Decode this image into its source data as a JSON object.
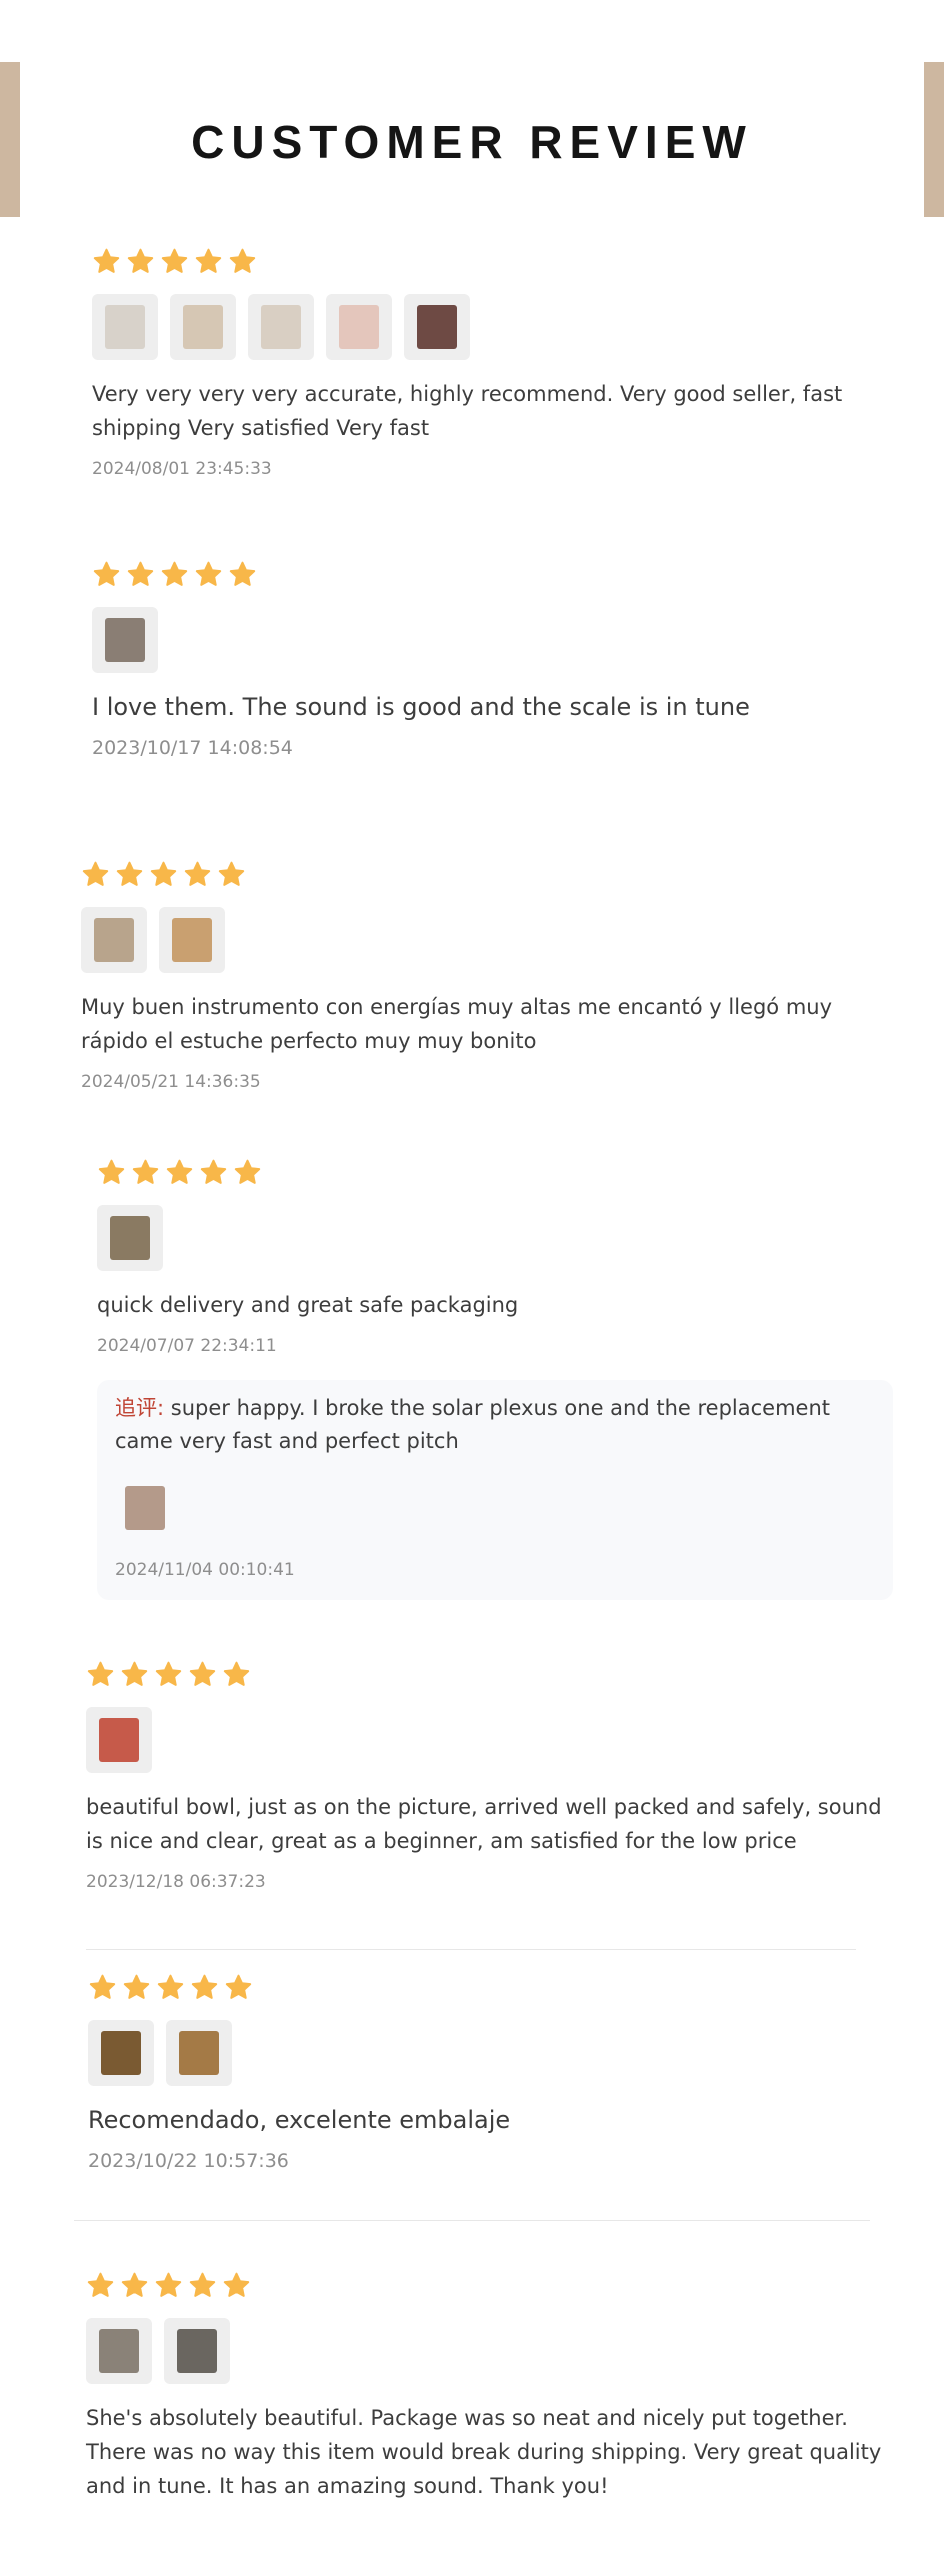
{
  "page": {
    "title": "CUSTOMER REVIEW"
  },
  "colors": {
    "accent_bar": "#cdb7a0",
    "star": "#f8b749",
    "followup_label": "#c04535",
    "date": "#8e8e8e"
  },
  "icons": {
    "star": "star-icon"
  },
  "reviews": [
    {
      "rating": 5,
      "thumbs": [
        "#d8d2ca",
        "#d6c7b4",
        "#d9cfc3",
        "#e4c6bc",
        "#6e4a44"
      ],
      "text": "Very very very very accurate, highly recommend. Very good seller, fast shipping Very satisfied Very fast",
      "date": "2024/08/01 23:45:33"
    },
    {
      "rating": 5,
      "thumbs": [
        "#8a7e74"
      ],
      "text": "I love them. The sound is good and the scale is in tune",
      "date": "2023/10/17 14:08:54"
    },
    {
      "rating": 5,
      "thumbs": [
        "#b8a48c",
        "#c9a070"
      ],
      "text": "Muy buen instrumento con energías muy altas me encantó y llegó muy rápido el estuche perfecto muy muy bonito",
      "date": "2024/05/21 14:36:35"
    },
    {
      "rating": 5,
      "thumbs": [
        "#8a7a62"
      ],
      "text": "quick delivery and great safe packaging",
      "date": "2024/07/07 22:34:11",
      "followup": {
        "label": "追评:",
        "text": "super happy. I broke the solar plexus one and the replacement came very fast and perfect pitch",
        "thumbs": [
          "#b49a8a"
        ],
        "date": "2024/11/04 00:10:41"
      }
    },
    {
      "rating": 5,
      "thumbs": [
        "#c65a4a"
      ],
      "text": "beautiful bowl, just as on the picture, arrived well packed and safely, sound is nice and clear, great as a beginner, am satisfied for the low price",
      "date": "2023/12/18 06:37:23"
    },
    {
      "rating": 5,
      "thumbs": [
        "#7a5a32",
        "#a47a46"
      ],
      "text": "Recomendado, excelente embalaje",
      "date": "2023/10/22 10:57:36"
    },
    {
      "rating": 5,
      "thumbs": [
        "#8a8278",
        "#6a6660"
      ],
      "text": "She's absolutely beautiful. Package was so neat and nicely put together. There was no way this item would break during shipping. Very great quality and in tune. It has an amazing sound. Thank you!",
      "date": ""
    }
  ]
}
